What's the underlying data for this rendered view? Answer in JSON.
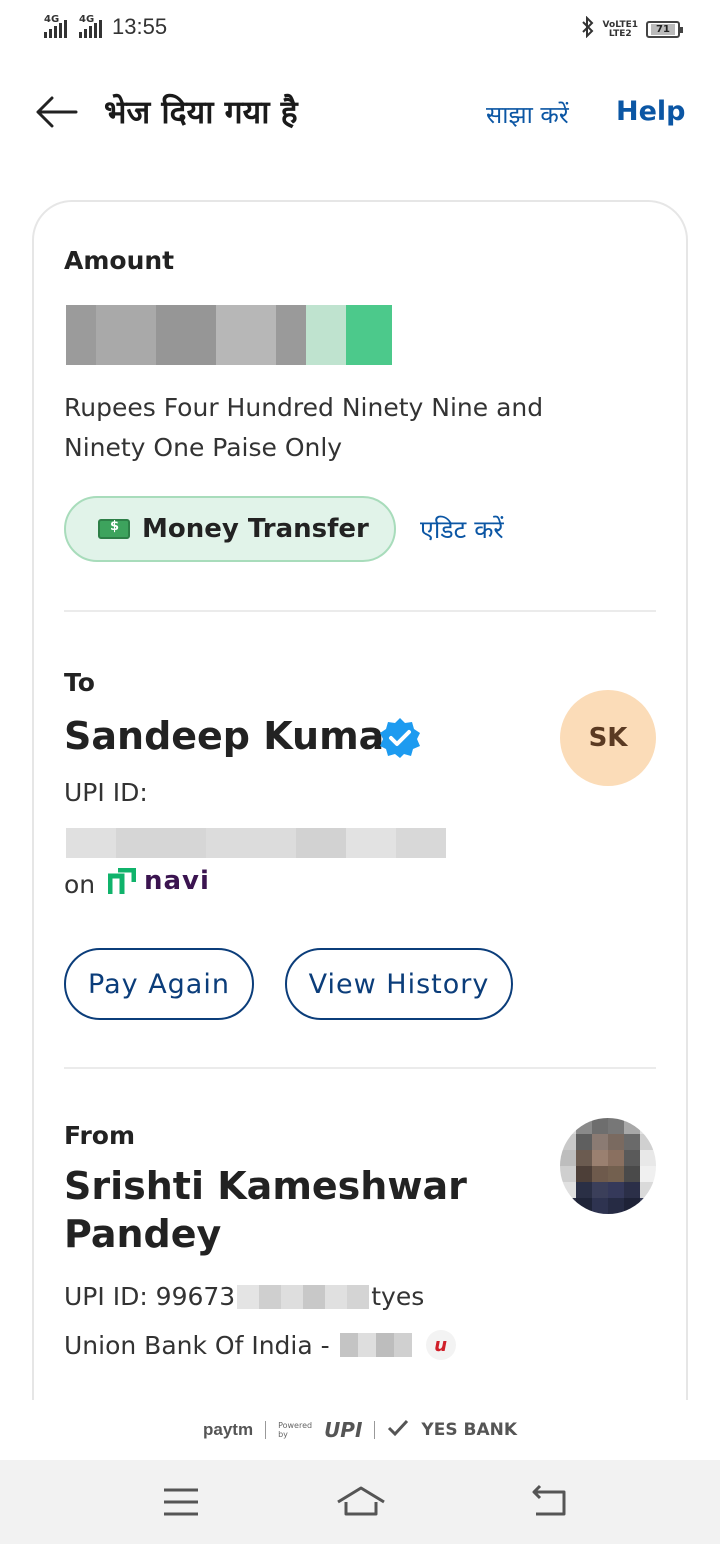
{
  "status_bar": {
    "signal1_label": "4G",
    "signal2_label": "4G",
    "time": "13:55",
    "volte_line1": "VoLTE1",
    "volte_line2": "LTE2",
    "battery": "71"
  },
  "header": {
    "title": "भेज दिया गया है",
    "share_label": "साझा करें",
    "help_label": "Help"
  },
  "amount_section": {
    "label": "Amount",
    "words": "Rupees Four Hundred Ninety Nine and Ninety One Paise Only",
    "category_chip": "Money Transfer",
    "edit_label": "एडिट करें"
  },
  "to_section": {
    "label": "To",
    "name": "Sandeep Kumar",
    "initials": "SK",
    "upi_label": "UPI ID:",
    "on_label": "on",
    "app_name": "navi",
    "pay_again_label": "Pay Again",
    "view_history_label": "View History"
  },
  "from_section": {
    "label": "From",
    "name": "Srishti Kameshwar Pandey",
    "upi_prefix": "UPI ID: 99673",
    "upi_suffix": "tyes",
    "bank_prefix": "Union Bank Of India - "
  },
  "footer": {
    "paytm": "paytm",
    "powered_by": "Powered by",
    "upi": "UPI",
    "bank": "YES BANK"
  },
  "colors": {
    "link_blue": "#0b56a4",
    "button_border": "#0b3d7a",
    "chip_bg": "#e1f3e9",
    "avatar_bg": "#fbdcb8",
    "verified_blue": "#1d9bf0"
  }
}
